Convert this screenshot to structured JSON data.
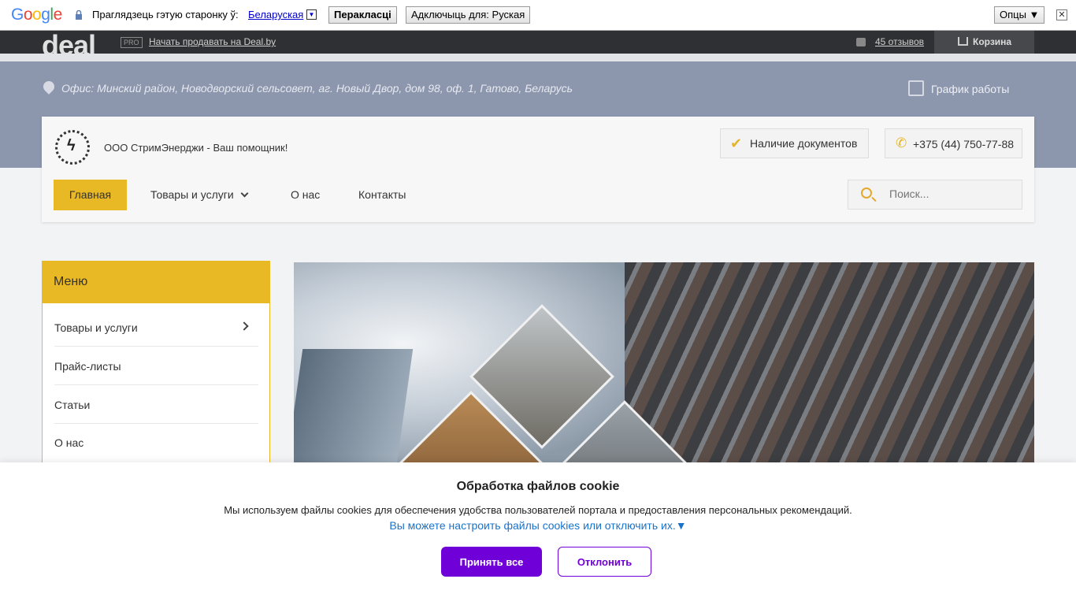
{
  "translate_bar": {
    "logo_letters": [
      "G",
      "o",
      "o",
      "g",
      "l",
      "e"
    ],
    "logo_colors": [
      "#4285f4",
      "#ea4335",
      "#fbbc05",
      "#4285f4",
      "#34a853",
      "#ea4335"
    ],
    "prompt": "Праглядзець гэтую старонку ў:",
    "language": "Беларуская",
    "translate_button": "Перакласці",
    "disable_button": "Адключыць для: Руская",
    "options_button": "Опцы ▼",
    "close": "✕"
  },
  "deal_bar": {
    "logo": "deal",
    "pro_badge": "PRO",
    "sell_link": "Начать продавать на Deal.by",
    "reviews_link": "45 отзывов",
    "cart_label": "Корзина"
  },
  "info": {
    "office": "Офис: Минский район, Новодворский сельсовет, аг. Новый Двор, дом 98, оф. 1, Гатово, Беларусь",
    "schedule": "График работы"
  },
  "header": {
    "company_name": "ООО СтримЭнерджи - Ваш помощник!",
    "docs_button": "Наличие документов",
    "phone": "+375 (44) 750-77-88"
  },
  "nav": {
    "home": "Главная",
    "goods": "Товары и услуги",
    "about": "О нас",
    "contacts": "Контакты",
    "search_placeholder": "Поиск..."
  },
  "side_menu": {
    "title": "Меню",
    "items": [
      {
        "label": "Товары и услуги"
      },
      {
        "label": "Прайс-листы"
      },
      {
        "label": "Статьи"
      },
      {
        "label": "О нас"
      }
    ]
  },
  "cookie": {
    "title": "Обработка файлов cookie",
    "text": "Мы используем файлы cookies для обеспечения удобства пользователей портала и предоставления персональных рекомендаций.",
    "link": "Вы можете настроить файлы cookies или отключить их.▼",
    "accept": "Принять все",
    "decline": "Отклонить"
  },
  "colors": {
    "accent_yellow": "#e9b825",
    "band_blue": "#8c96ad",
    "cookie_purple": "#7000d8"
  }
}
